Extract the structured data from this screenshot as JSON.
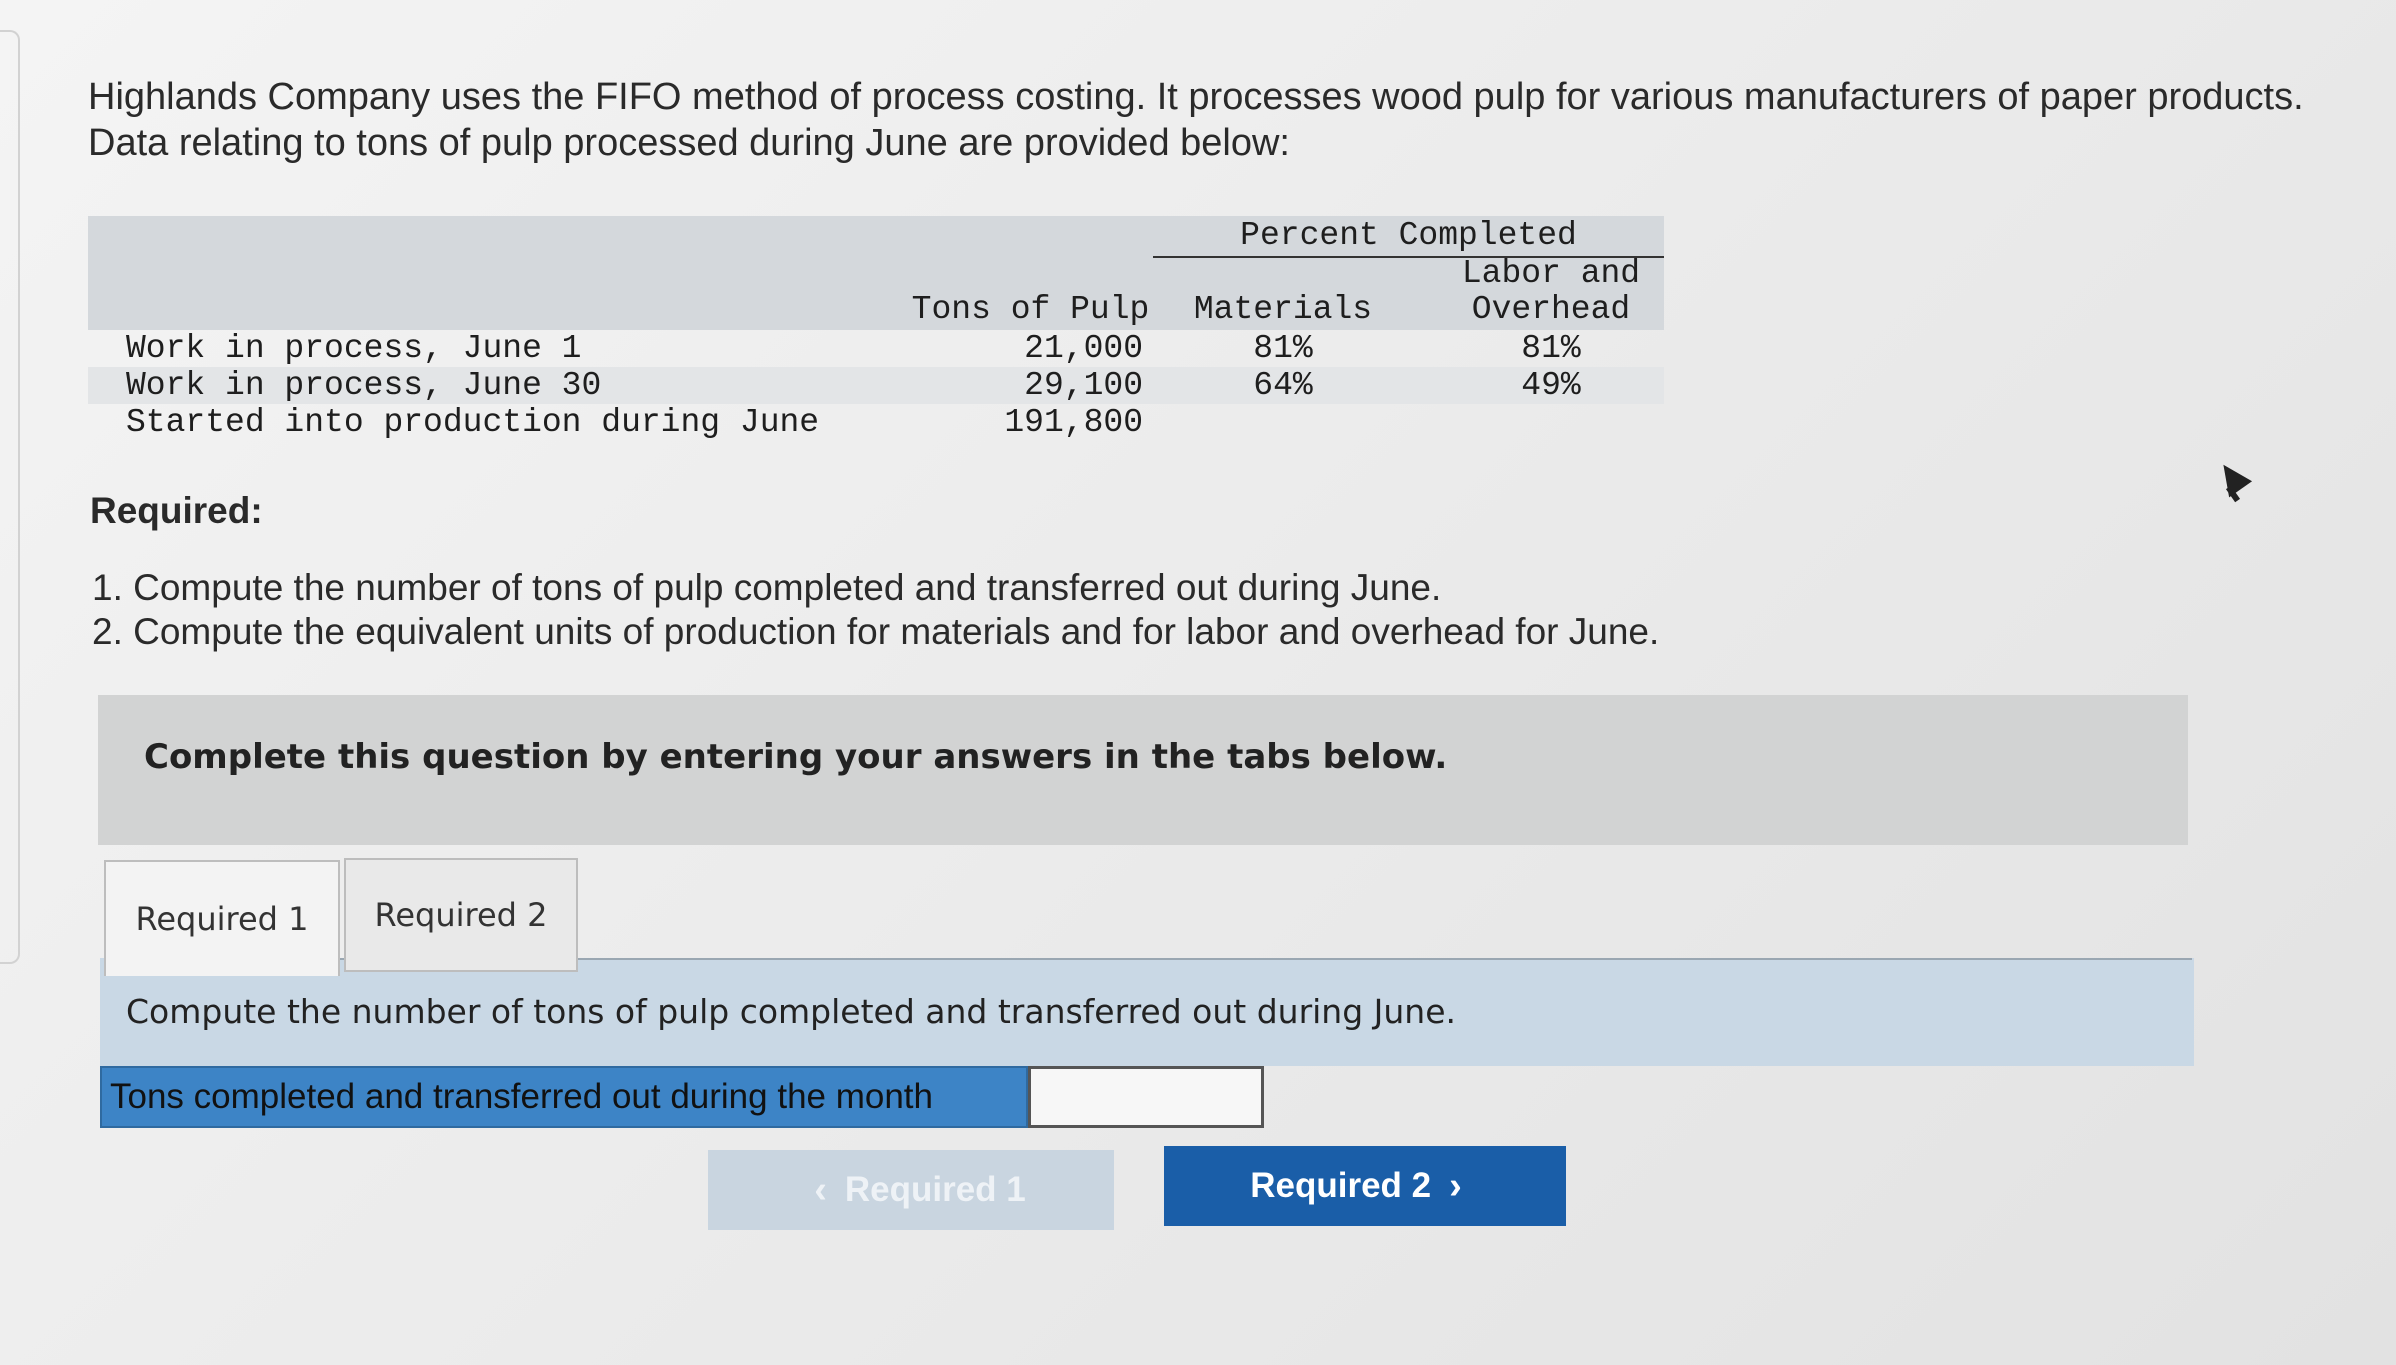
{
  "intro": {
    "line1": "Highlands Company uses the FIFO method of process costing. It processes wood pulp for various manufacturers of paper products.",
    "line2": "Data relating to tons of pulp processed during June are provided below:"
  },
  "table": {
    "percent_completed_header": "Percent Completed",
    "col_tons": "Tons of Pulp",
    "col_materials": "Materials",
    "col_labor_line1": "Labor and",
    "col_labor_line2": "Overhead",
    "rows": [
      {
        "label": "Work in process, June 1",
        "tons": "21,000",
        "materials": "81%",
        "labor": "81%"
      },
      {
        "label": "Work in process, June 30",
        "tons": "29,100",
        "materials": "64%",
        "labor": "49%"
      },
      {
        "label": "Started into production during June",
        "tons": "191,800",
        "materials": "",
        "labor": ""
      }
    ]
  },
  "required": {
    "heading": "Required:",
    "items": [
      "1. Compute the number of tons of pulp completed and transferred out during June.",
      "2. Compute the equivalent units of production for materials and for labor and overhead for June."
    ]
  },
  "instruction": "Complete this question by entering your answers in the tabs below.",
  "tabs": [
    {
      "label": "Required 1",
      "active": true
    },
    {
      "label": "Required 2",
      "active": false
    }
  ],
  "prompt": "Compute the number of tons of pulp completed and transferred out during June.",
  "answer": {
    "label": "Tons completed and transferred out during the month",
    "value": ""
  },
  "nav": {
    "prev_label": "Required 1",
    "next_label": "Required 2"
  },
  "icons": {
    "prev": "chevron-left-icon",
    "next": "chevron-right-icon",
    "cursor": "mouse-pointer-icon"
  },
  "colors": {
    "next_button": "#1a5ea8",
    "answer_label_bg": "#3d84c6",
    "prompt_bg": "#c9d8e5"
  }
}
